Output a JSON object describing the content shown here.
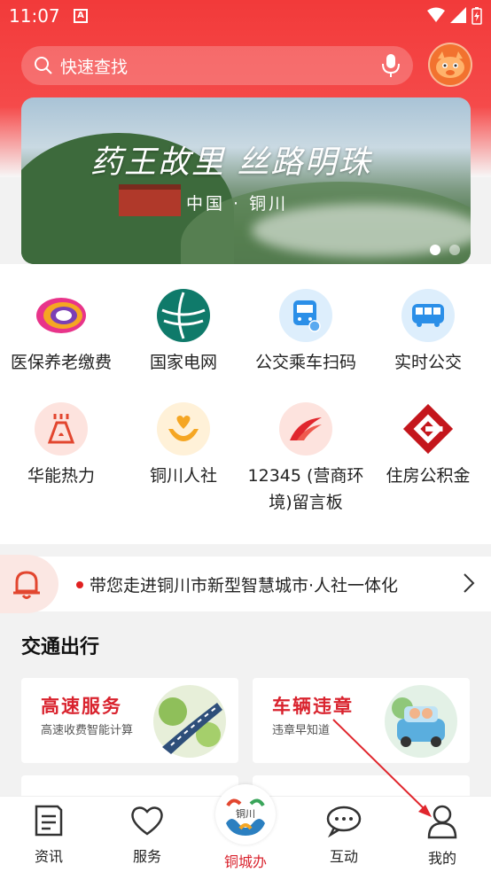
{
  "statusbar": {
    "time": "11:07",
    "badge": "A"
  },
  "search": {
    "placeholder": "快速查找"
  },
  "banner": {
    "title": "药王故里 丝路明珠",
    "subtitle": "中国 · 铜川"
  },
  "services": [
    {
      "label": "医保养老缴费",
      "icon": "colorful-ring-icon"
    },
    {
      "label": "国家电网",
      "icon": "state-grid-globe-icon"
    },
    {
      "label": "公交乘车扫码",
      "icon": "bus-scan-icon"
    },
    {
      "label": "实时公交",
      "icon": "bus-icon"
    },
    {
      "label": "华能热力",
      "icon": "heating-icon"
    },
    {
      "label": "铜川人社",
      "icon": "hands-heart-icon"
    },
    {
      "label": "12345 (营商环境)留言板",
      "icon": "hotline-logo-icon"
    },
    {
      "label": "住房公积金",
      "icon": "housing-fund-logo-icon"
    }
  ],
  "notice": {
    "text": "带您走进铜川市新型智慧城市·人社一体化"
  },
  "section": {
    "title": "交通出行"
  },
  "cards": [
    {
      "title": "高速服务",
      "subtitle": "高速收费智能计算"
    },
    {
      "title": "车辆违章",
      "subtitle": "违章早知道"
    }
  ],
  "tabs": [
    {
      "label": "资讯",
      "icon": "news-icon"
    },
    {
      "label": "服务",
      "icon": "heart-icon"
    },
    {
      "label": "铜城办",
      "icon": "city-logo-icon",
      "logo_text": "铜川"
    },
    {
      "label": "互动",
      "icon": "chat-icon"
    },
    {
      "label": "我的",
      "icon": "person-icon"
    }
  ],
  "colors": {
    "accent": "#d9232e",
    "header": "#f23a3a"
  }
}
